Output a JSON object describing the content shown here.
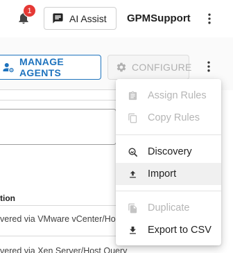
{
  "header": {
    "notification_count": "1",
    "ai_assist_label": "AI Assist",
    "org_name": "GPMSupport"
  },
  "toolbar": {
    "manage_agents_label": "MANAGE AGENTS",
    "configure_label": "CONFIGURE"
  },
  "table": {
    "column_header": "tion",
    "rows": [
      "vered via VMware vCenter/Host",
      "vered via Xen Server/Host Query"
    ]
  },
  "menu": {
    "items": [
      {
        "label": "Assign Rules",
        "icon": "clipboard-icon",
        "disabled": true
      },
      {
        "label": "Copy Rules",
        "icon": "copy-icon",
        "disabled": true
      },
      {
        "label": "Discovery",
        "icon": "discovery-icon",
        "disabled": false
      },
      {
        "label": "Import",
        "icon": "upload-icon",
        "disabled": false
      },
      {
        "label": "Duplicate",
        "icon": "duplicate-icon",
        "disabled": true
      },
      {
        "label": "Export to CSV",
        "icon": "download-icon",
        "disabled": false
      }
    ]
  },
  "colors": {
    "accent": "#1e73be",
    "badge": "#e53935",
    "disabled_text": "#b5b5b5"
  }
}
